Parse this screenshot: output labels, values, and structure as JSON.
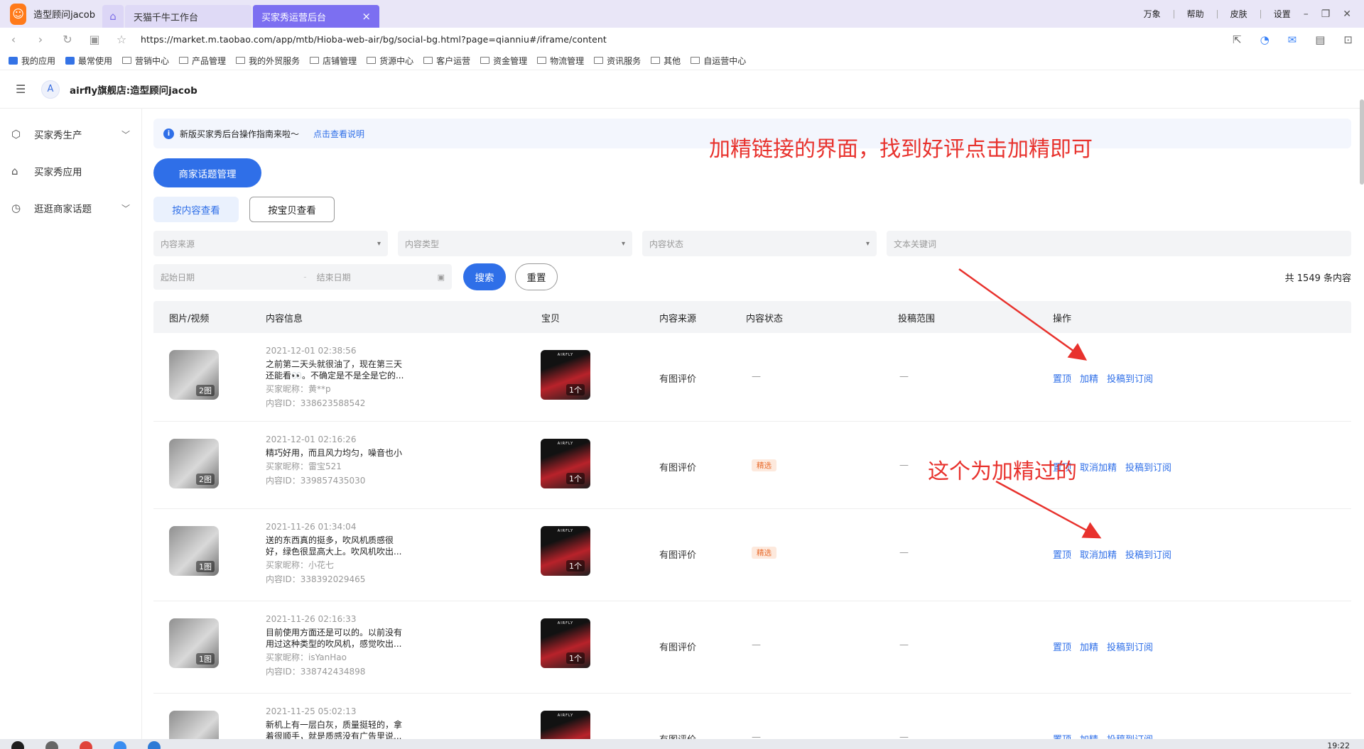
{
  "browser": {
    "profile_name": "造型顾问jacob",
    "tabs": [
      {
        "label": "天猫千牛工作台"
      },
      {
        "label": "买家秀运营后台"
      }
    ],
    "close_glyph": "×",
    "window_menu": [
      "万象",
      "帮助",
      "皮肤",
      "设置"
    ],
    "url": "https://market.m.taobao.com/app/mtb/Hioba-web-air/bg/social-bg.html?page=qianniu#/iframe/content",
    "bookmarks": [
      "我的应用",
      "最常使用",
      "营销中心",
      "产品管理",
      "我的外贸服务",
      "店铺管理",
      "货源中心",
      "客户运营",
      "资金管理",
      "物流管理",
      "资讯服务",
      "其他",
      "自运营中心"
    ]
  },
  "app": {
    "avatar_letter": "A",
    "shop_name": "airfly旗舰店:造型顾问jacob"
  },
  "sidebar": {
    "items": [
      {
        "label": "买家秀生产",
        "icon": "box-icon",
        "expandable": true
      },
      {
        "label": "买家秀应用",
        "icon": "apps-icon",
        "expandable": false
      },
      {
        "label": "逛逛商家话题",
        "icon": "pie-icon",
        "expandable": true
      }
    ]
  },
  "notice": {
    "text": "新版买家秀后台操作指南来啦～",
    "link": "点击查看说明"
  },
  "annotations": {
    "top": "加精链接的界面，找到好评点击加精即可",
    "middle": "这个为加精过的"
  },
  "toolbar": {
    "manage_topics": "商家话题管理",
    "view_by_content": "按内容查看",
    "view_by_item": "按宝贝查看"
  },
  "filters": {
    "source_placeholder": "内容来源",
    "type_placeholder": "内容类型",
    "status_placeholder": "内容状态",
    "keyword_placeholder": "文本关键词",
    "start_date": "起始日期",
    "end_date": "结束日期",
    "date_sep": "-",
    "search": "搜索",
    "reset": "重置",
    "total": "共 1549 条内容"
  },
  "table": {
    "headers": [
      "图片/视频",
      "内容信息",
      "宝贝",
      "内容来源",
      "内容状态",
      "投稿范围",
      "操作"
    ],
    "rows": [
      {
        "media_badge": "2图",
        "date": "2021-12-01 02:38:56",
        "text": "之前第二天头就很油了，现在第三天还能看👀。不确定是不是全是它的...",
        "nick": "买家昵称：黄**p",
        "content_id": "内容ID：338623588542",
        "item_badge": "1个",
        "source": "有图评价",
        "status": "—",
        "featured": false,
        "scope": "—",
        "actions": [
          "置顶",
          "加精",
          "投稿到订阅"
        ]
      },
      {
        "media_badge": "2图",
        "date": "2021-12-01 02:16:26",
        "text": "精巧好用，而且风力均匀，噪音也小",
        "nick": "买家昵称：雷宝521",
        "content_id": "内容ID：339857435030",
        "item_badge": "1个",
        "source": "有图评价",
        "status": "精选",
        "featured": true,
        "scope": "—",
        "actions": [
          "置顶",
          "取消加精",
          "投稿到订阅"
        ]
      },
      {
        "media_badge": "1图",
        "date": "2021-11-26 01:34:04",
        "text": "送的东西真的挺多，吹风机质感很好，绿色很显高大上。吹风机吹出...",
        "nick": "买家昵称：小花七",
        "content_id": "内容ID：338392029465",
        "item_badge": "1个",
        "source": "有图评价",
        "status": "精选",
        "featured": true,
        "scope": "—",
        "actions": [
          "置顶",
          "取消加精",
          "投稿到订阅"
        ]
      },
      {
        "media_badge": "1图",
        "date": "2021-11-26 02:16:33",
        "text": "目前使用方面还是可以的。以前没有用过这种类型的吹风机，感觉吹出...",
        "nick": "买家昵称：isYanHao",
        "content_id": "内容ID：338742434898",
        "item_badge": "1个",
        "source": "有图评价",
        "status": "—",
        "featured": false,
        "scope": "—",
        "actions": [
          "置顶",
          "加精",
          "投稿到订阅"
        ]
      },
      {
        "media_badge": "",
        "date": "2021-11-25 05:02:13",
        "text": "新机上有一层白灰，质量挺轻的，拿着很顺手，就是质感没有广告里说...",
        "nick": "",
        "content_id": "",
        "item_badge": "1个",
        "source": "有图评价",
        "status": "—",
        "featured": false,
        "scope": "—",
        "actions": [
          "置顶",
          "加精",
          "投稿到订阅"
        ]
      }
    ]
  },
  "product_thumb_text": "AIRFLY",
  "taskbar": {
    "clock": "19:22"
  },
  "colors": {
    "accent": "#2f6fe8",
    "annotation": "#e8322d",
    "featured_tag": "#e86a2b",
    "tab_active": "#7c6ff1"
  }
}
